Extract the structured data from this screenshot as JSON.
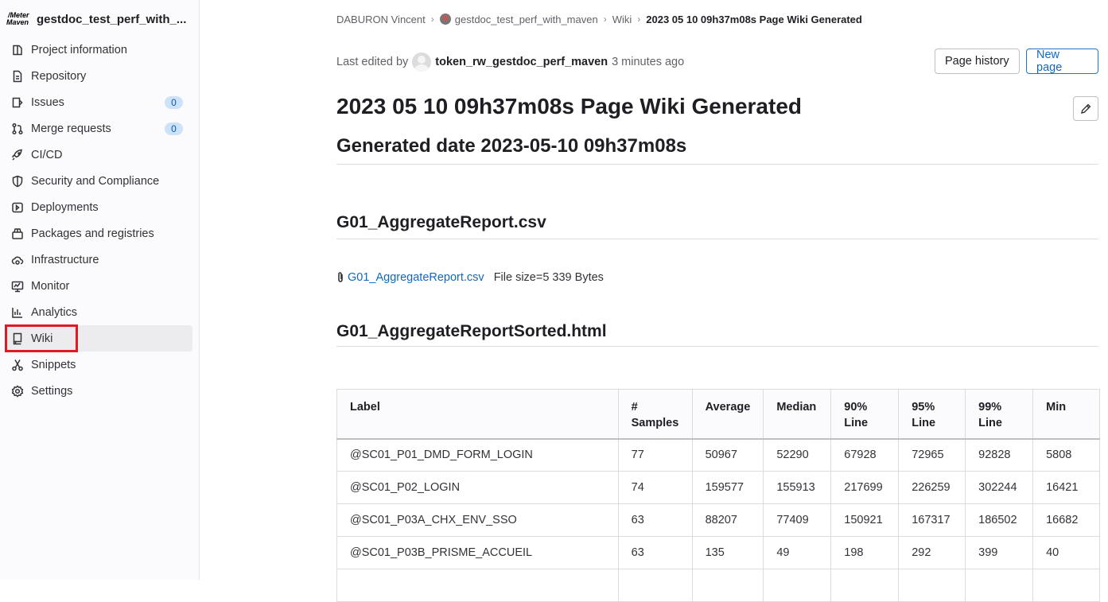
{
  "project": {
    "name": "gestdoc_test_perf_with_maven",
    "display_name": "gestdoc_test_perf_with_...",
    "logo_line1": "/Meter",
    "logo_line2": "Maven"
  },
  "sidebar": {
    "items": [
      {
        "label": "Project information",
        "icon": "project-icon"
      },
      {
        "label": "Repository",
        "icon": "document-icon"
      },
      {
        "label": "Issues",
        "icon": "issues-icon",
        "badge": "0"
      },
      {
        "label": "Merge requests",
        "icon": "merge-request-icon",
        "badge": "0"
      },
      {
        "label": "CI/CD",
        "icon": "rocket-icon"
      },
      {
        "label": "Security and Compliance",
        "icon": "shield-icon"
      },
      {
        "label": "Deployments",
        "icon": "deployments-icon"
      },
      {
        "label": "Packages and registries",
        "icon": "package-icon"
      },
      {
        "label": "Infrastructure",
        "icon": "cloud-gear-icon"
      },
      {
        "label": "Monitor",
        "icon": "monitor-icon"
      },
      {
        "label": "Analytics",
        "icon": "chart-icon"
      },
      {
        "label": "Wiki",
        "icon": "book-icon",
        "active": true
      },
      {
        "label": "Snippets",
        "icon": "scissors-icon"
      },
      {
        "label": "Settings",
        "icon": "settings-icon"
      }
    ]
  },
  "breadcrumb": {
    "items": [
      "DABURON Vincent",
      "gestdoc_test_perf_with_maven",
      "Wiki"
    ],
    "current": "2023 05 10 09h37m08s Page Wiki Generated"
  },
  "header": {
    "last_edited_by": "Last edited by",
    "user": "token_rw_gestdoc_perf_maven",
    "time_ago": "3 minutes ago",
    "page_history": "Page history",
    "new_page": "New page"
  },
  "page": {
    "title": "2023 05 10 09h37m08s Page Wiki Generated",
    "generated": "Generated date 2023-05-10 09h37m08s",
    "section1": "G01_AggregateReport.csv",
    "file_link": "G01_AggregateReport.csv",
    "file_size": "File size=5 339 Bytes",
    "section2": "G01_AggregateReportSorted.html"
  },
  "table": {
    "headers": [
      [
        "Label"
      ],
      [
        "#",
        "Samples"
      ],
      [
        "Average"
      ],
      [
        "Median"
      ],
      [
        "90%",
        "Line"
      ],
      [
        "95%",
        "Line"
      ],
      [
        "99%",
        "Line"
      ],
      [
        "Min"
      ]
    ],
    "rows": [
      [
        "@SC01_P01_DMD_FORM_LOGIN",
        "77",
        "50967",
        "52290",
        "67928",
        "72965",
        "92828",
        "5808"
      ],
      [
        "@SC01_P02_LOGIN",
        "74",
        "159577",
        "155913",
        "217699",
        "226259",
        "302244",
        "16421"
      ],
      [
        "@SC01_P03A_CHX_ENV_SSO",
        "63",
        "88207",
        "77409",
        "150921",
        "167317",
        "186502",
        "16682"
      ],
      [
        "@SC01_P03B_PRISME_ACCUEIL",
        "63",
        "135",
        "49",
        "198",
        "292",
        "399",
        "40"
      ],
      [
        "",
        "",
        "",
        "",
        "",
        "",
        "",
        ""
      ]
    ]
  },
  "colors": {
    "accent": "#1068bf",
    "badge_bg": "#cbe2f9",
    "highlight": "#e01a22"
  }
}
